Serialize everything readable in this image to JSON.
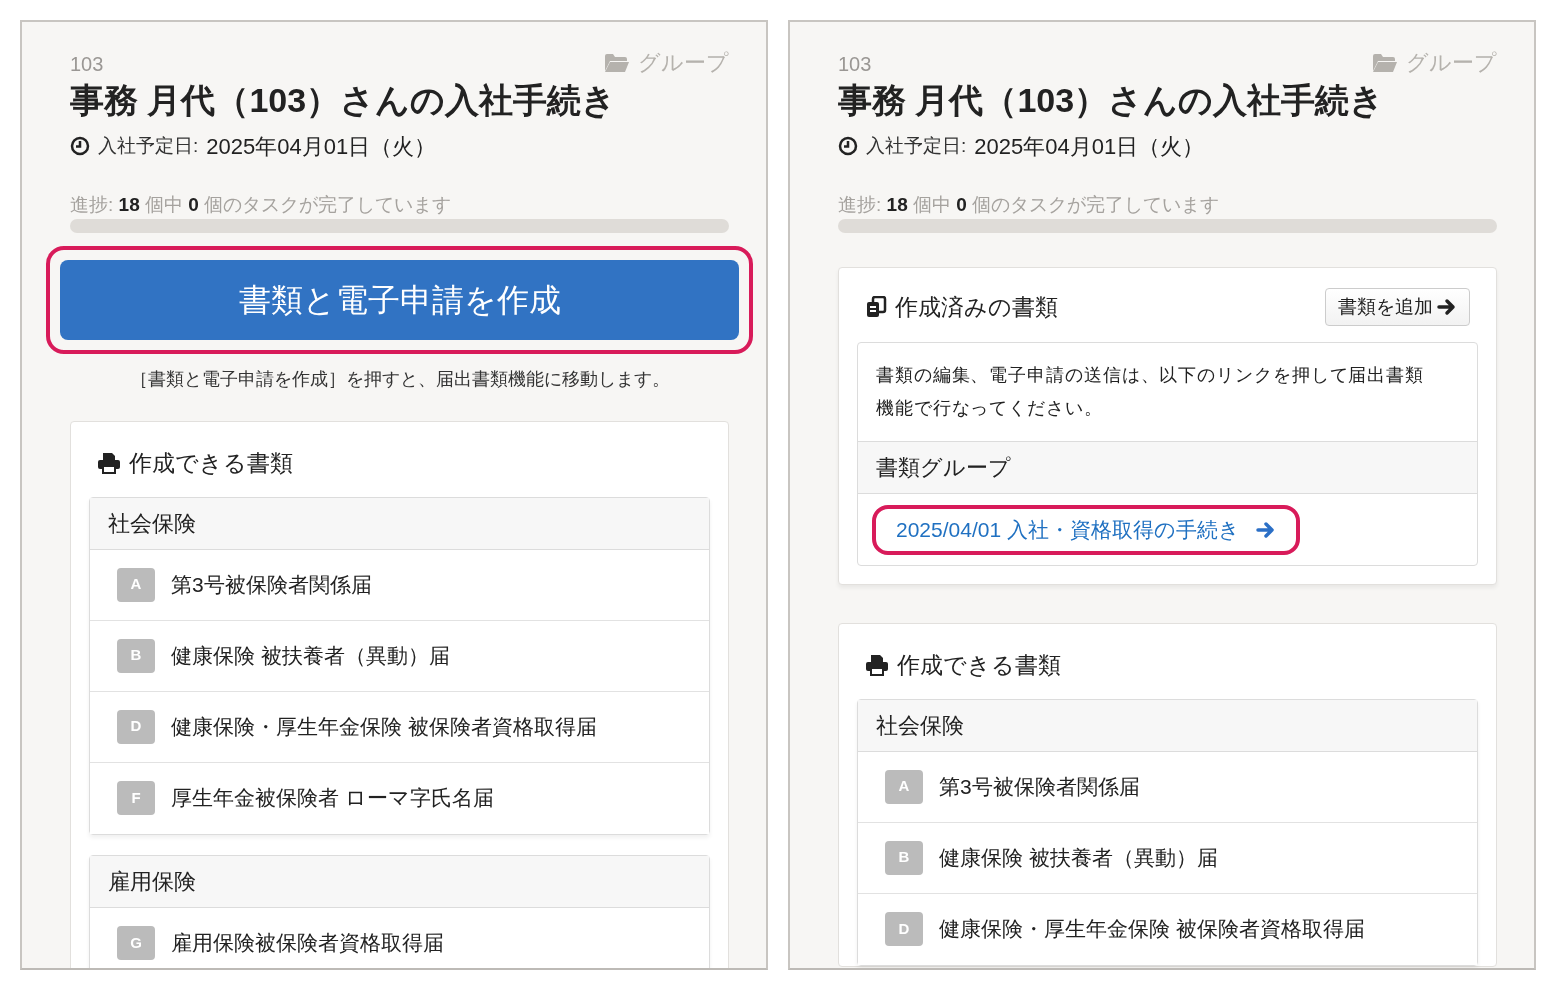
{
  "panels": [
    {
      "employee_no": "103",
      "group_link": "グループ",
      "title": "事務 月代（103）さんの入社手続き",
      "start_date_label": "入社予定日:",
      "start_date": "2025年04月01日（火）",
      "progress": {
        "text": "進捗: **18** 個中 **0** 個のタスクが完了しています",
        "level": 0
      },
      "create_button": {
        "label": "書類と電子申請を作成",
        "highlighted": true
      },
      "create_note": "［書類と電子申請を作成］を押すと、届出書類機能に移動します。",
      "available": {
        "title": "作成できる書類",
        "groups": [
          {
            "name": "社会保険",
            "forms": [
              {
                "badge": "A",
                "name": "第3号被保険者関係届"
              },
              {
                "badge": "B",
                "name": "健康保険 被扶養者（異動）届"
              },
              {
                "badge": "D",
                "name": "健康保険・厚生年金保険 被保険者資格取得届"
              },
              {
                "badge": "F",
                "name": "厚生年金被保険者 ローマ字氏名届"
              }
            ]
          },
          {
            "name": "雇用保険",
            "forms": [
              {
                "badge": "G",
                "name": "雇用保険被保険者資格取得届"
              }
            ]
          }
        ]
      }
    },
    {
      "employee_no": "103",
      "group_link": "グループ",
      "title": "事務 月代（103）さんの入社手続き",
      "start_date_label": "入社予定日:",
      "start_date": "2025年04月01日（火）",
      "progress": {
        "text": "進捗: **18** 個中 **0** 個のタスクが完了しています",
        "level": 0
      },
      "created_docs": {
        "title": "作成済みの書類",
        "add_button": "書類を追加",
        "description": "書類の編集、電子申請の送信は、以下のリンクを押して届出書類機能で行なってください。",
        "group_header": "書類グループ",
        "link": {
          "label": "2025/04/01 入社・資格取得の手続き",
          "highlighted": true
        }
      },
      "available": {
        "title": "作成できる書類",
        "groups": [
          {
            "name": "社会保険",
            "forms": [
              {
                "badge": "A",
                "name": "第3号被保険者関係届"
              },
              {
                "badge": "B",
                "name": "健康保険 被扶養者（異動）届"
              },
              {
                "badge": "D",
                "name": "健康保険・厚生年金保険 被保険者資格取得届"
              }
            ]
          }
        ]
      }
    }
  ]
}
